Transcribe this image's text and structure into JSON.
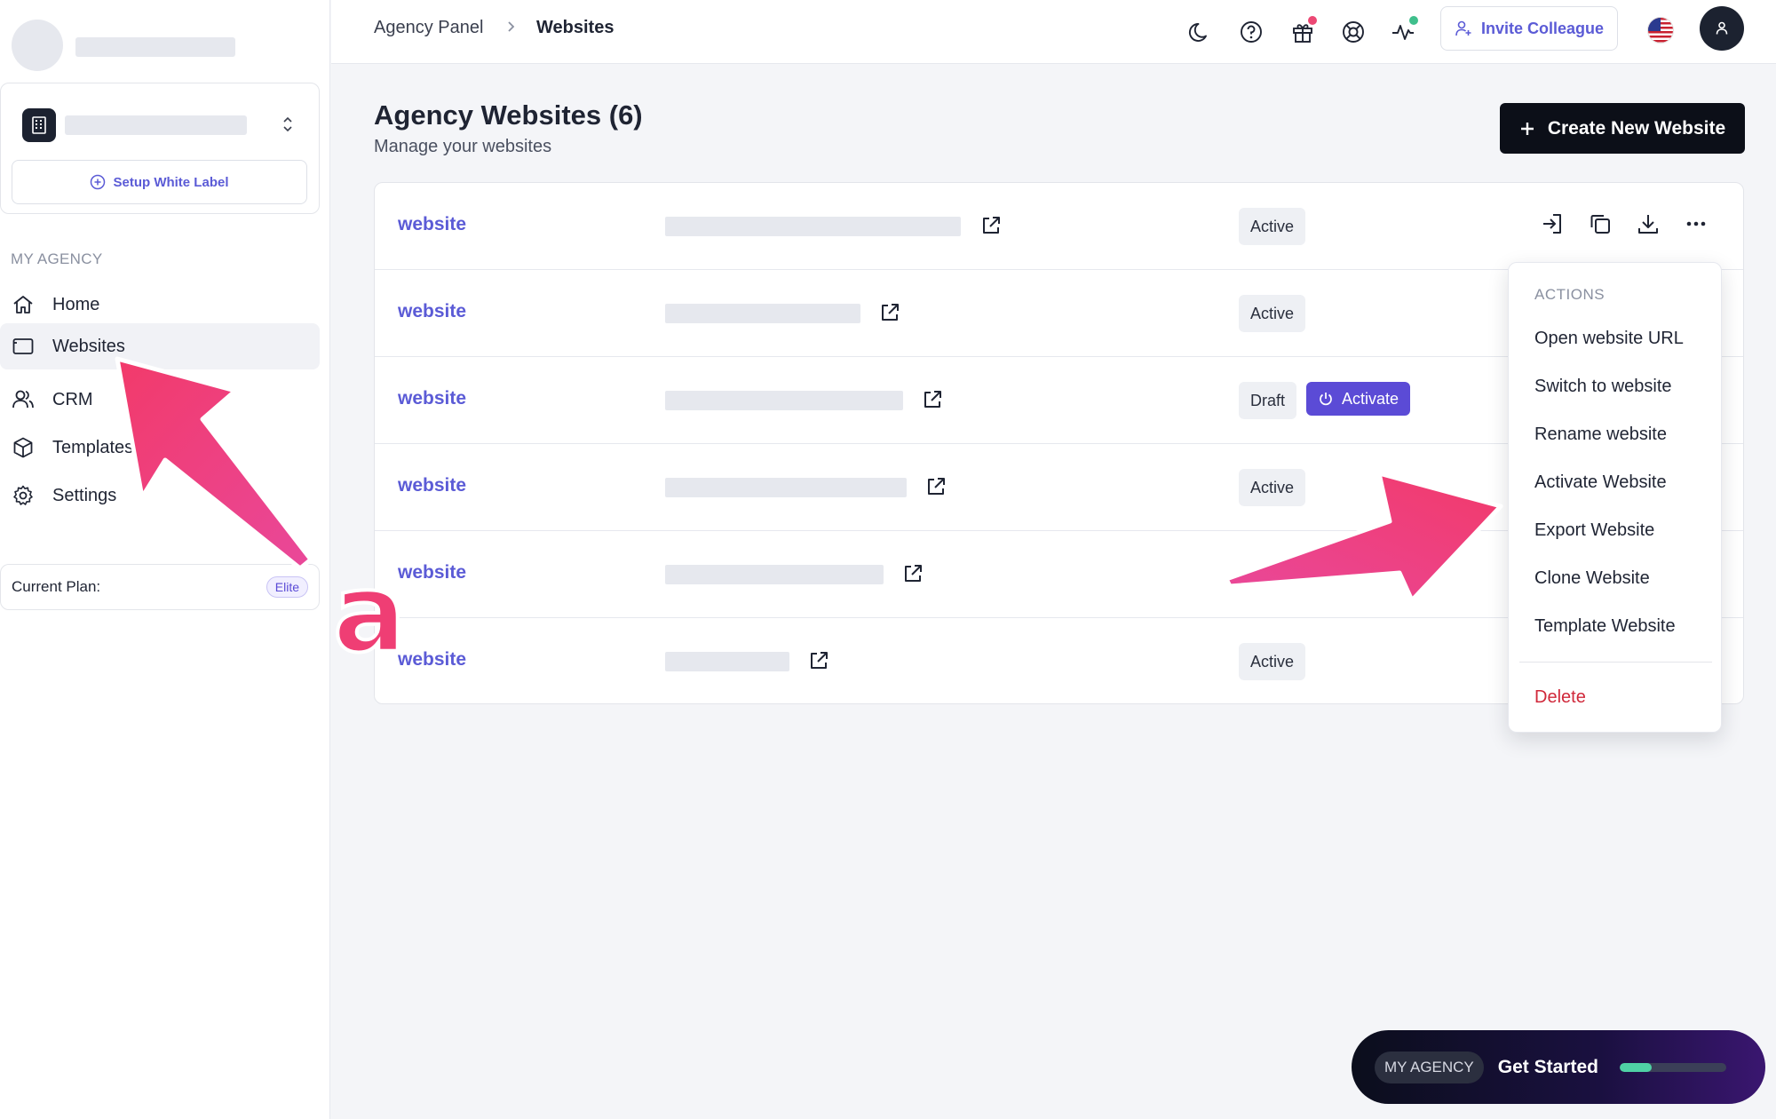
{
  "sidebar": {
    "white_label_button": "Setup White Label",
    "section_label": "MY AGENCY",
    "nav": [
      {
        "label": "Home",
        "icon": "home-icon"
      },
      {
        "label": "Websites",
        "icon": "browser-window-icon",
        "active": true
      },
      {
        "label": "CRM",
        "icon": "users-icon"
      },
      {
        "label": "Templates",
        "icon": "cube-icon"
      },
      {
        "label": "Settings",
        "icon": "gear-icon"
      }
    ],
    "plan_label": "Current Plan:",
    "plan_badge": "Elite"
  },
  "header": {
    "breadcrumb_root": "Agency Panel",
    "breadcrumb_current": "Websites",
    "invite_button": "Invite Colleague",
    "icons": [
      "moon-icon",
      "help-icon",
      "gift-icon",
      "lifebuoy-icon",
      "activity-icon"
    ]
  },
  "main": {
    "title": "Agency Websites (6)",
    "subtitle": "Manage your websites",
    "create_button": "Create New Website",
    "rows": [
      {
        "name": "website",
        "status": "Active"
      },
      {
        "name": "website",
        "status": "Active"
      },
      {
        "name": "website",
        "status": "Draft",
        "action": "Activate"
      },
      {
        "name": "website",
        "status": "Active"
      },
      {
        "name": "website",
        "status": ""
      },
      {
        "name": "website",
        "status": "Active"
      }
    ]
  },
  "dropdown": {
    "label": "ACTIONS",
    "items": [
      "Open website URL",
      "Switch to website",
      "Rename website",
      "Activate Website",
      "Export Website",
      "Clone Website",
      "Template Website"
    ],
    "danger_item": "Delete"
  },
  "widget": {
    "badge": "MY AGENCY",
    "text": "Get Started",
    "progress": 0.3
  },
  "annotation": {
    "letter": "a"
  },
  "colors": {
    "accent": "#5b5bd6",
    "primary_button": "#0c0f18",
    "danger": "#d0283a",
    "annotation": "#ef3e74"
  }
}
